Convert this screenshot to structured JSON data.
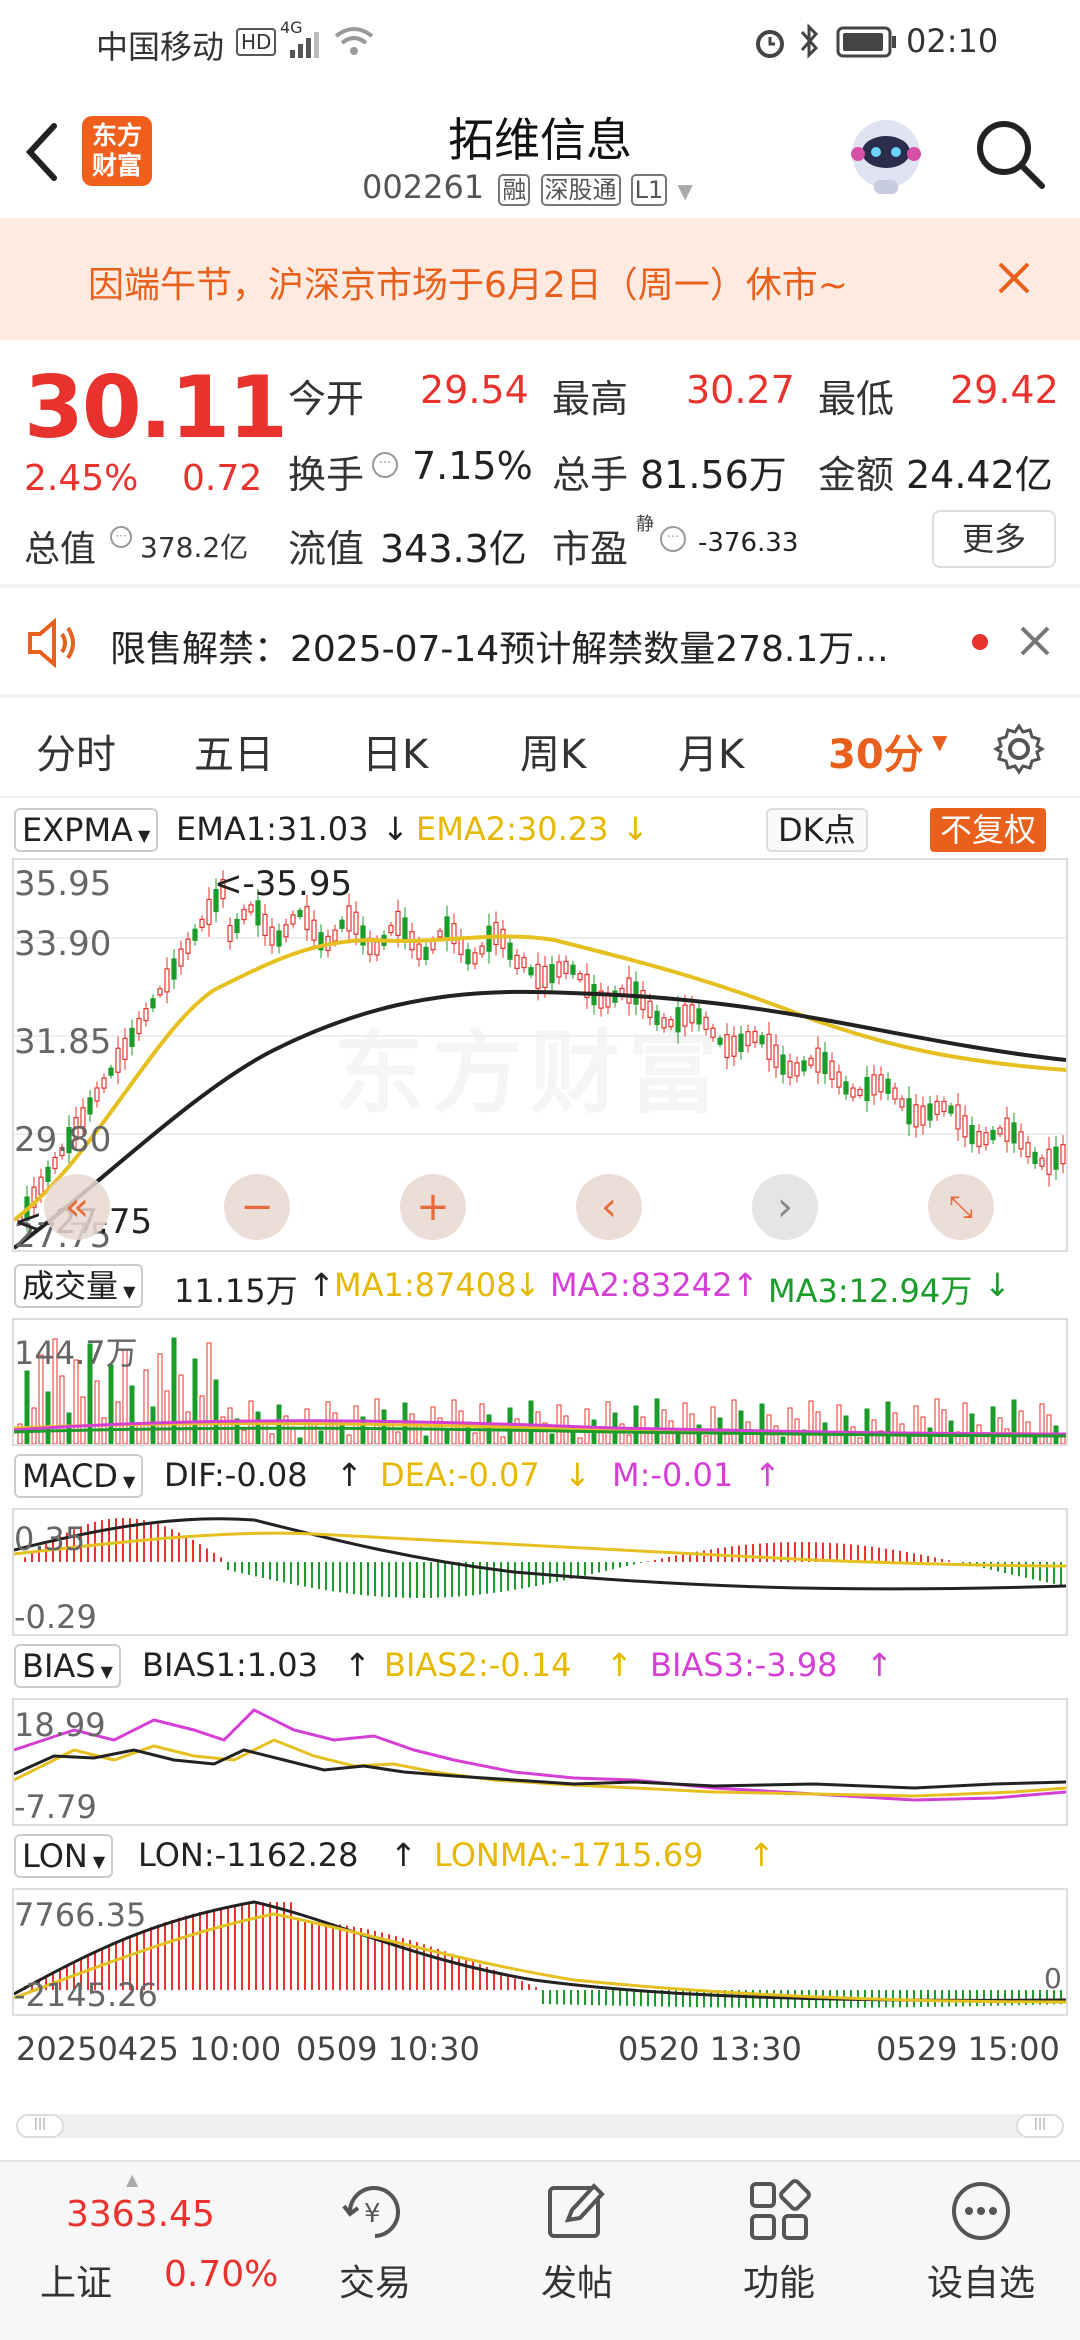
{
  "status_bar": {
    "carrier": "中国移动",
    "hd_badge": "HD",
    "network": "4G",
    "time": "02:10"
  },
  "header": {
    "logo_text": "东方财富",
    "stock_name": "拓维信息",
    "stock_code": "002261",
    "tags": [
      "融",
      "深股通",
      "L1"
    ]
  },
  "notice": {
    "text": "因端午节，沪深京市场于6月2日（周一）休市~"
  },
  "quote": {
    "price": "30.11",
    "change_pct": "2.45%",
    "change_abs": "0.72",
    "open_label": "今开",
    "open_value": "29.54",
    "high_label": "最高",
    "high_value": "30.27",
    "low_label": "最低",
    "low_value": "29.42",
    "turnover_label": "换手",
    "turnover_value": "7.15%",
    "volume_label": "总手",
    "volume_value": "81.56万",
    "amount_label": "金额",
    "amount_value": "24.42亿",
    "mktcap_label": "总值",
    "mktcap_value": "378.2亿",
    "float_label": "流值",
    "float_value": "343.3亿",
    "pe_label": "市盈",
    "pe_sup": "静",
    "pe_value": "-376.33",
    "more_label": "更多"
  },
  "alert": {
    "text": "限售解禁：2025-07-14预计解禁数量278.1万..."
  },
  "tabs": {
    "items": [
      "分时",
      "五日",
      "日K",
      "周K",
      "月K",
      "30分"
    ],
    "active_index": 5
  },
  "indicators": {
    "main": {
      "name": "EXPMA",
      "ema1": "EMA1:31.03",
      "ema2": "EMA2:30.23",
      "dk_label": "DK点",
      "adjust_label": "不复权",
      "y_labels": [
        "35.95",
        "33.90",
        "31.85",
        "29.80",
        "27.75"
      ],
      "max_marker": "<-35.95",
      "min_marker": "<-27.75"
    },
    "volume": {
      "name": "成交量",
      "value": "11.15万",
      "ma1": "MA1:87408",
      "ma2": "MA2:83242",
      "ma3": "MA3:12.94万",
      "y_label": "144.7万"
    },
    "macd": {
      "name": "MACD",
      "dif": "DIF:-0.08",
      "dea": "DEA:-0.07",
      "m": "M:-0.01",
      "y_top": "0.35",
      "y_bottom": "-0.29"
    },
    "bias": {
      "name": "BIAS",
      "bias1": "BIAS1:1.03",
      "bias2": "BIAS2:-0.14",
      "bias3": "BIAS3:-3.98",
      "y_top": "18.99",
      "y_bottom": "-7.79"
    },
    "lon": {
      "name": "LON",
      "lon": "LON:-1162.28",
      "lonma": "LONMA:-1715.69",
      "y_top": "7766.35",
      "y_bottom": "-2145.26",
      "right_label": "0"
    },
    "x_labels": [
      "20250425 10:00",
      "0509 10:30",
      "0520 13:30",
      "0529 15:00"
    ]
  },
  "bottom_nav": {
    "index_value": "3363.45",
    "index_name": "上证",
    "index_change": "0.70%",
    "items": [
      "交易",
      "发帖",
      "功能",
      "设自选"
    ]
  },
  "colors": {
    "up": "#e8322d",
    "down": "#1a9b2a",
    "ema2": "#e6b800",
    "ma2": "#d63fd6",
    "accent": "#e8601c"
  }
}
